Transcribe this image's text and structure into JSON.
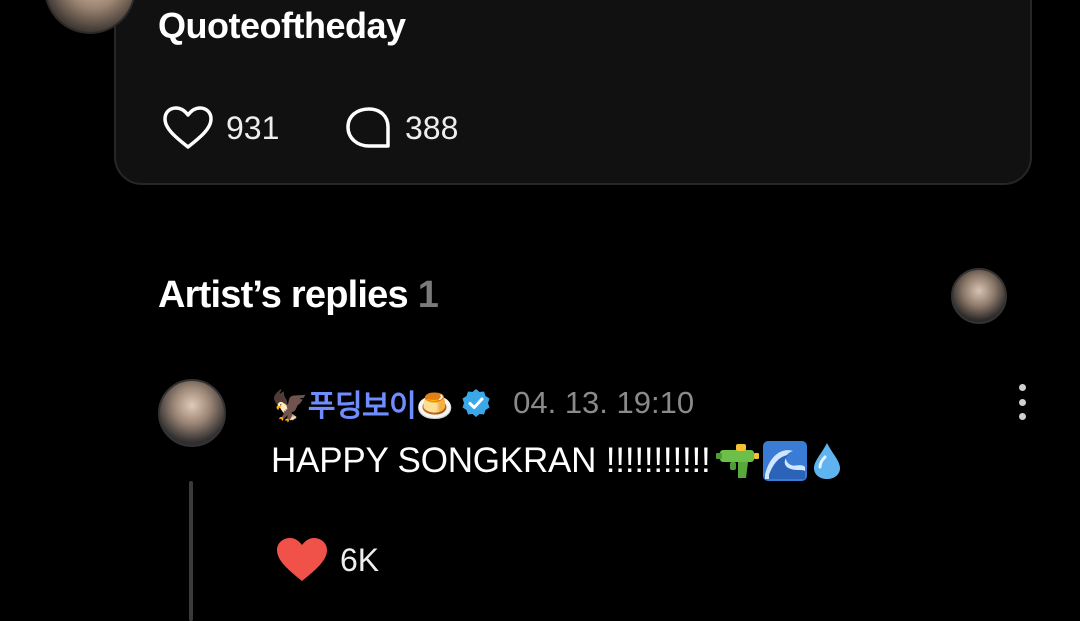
{
  "post": {
    "text": "Quoteoftheday",
    "likes": "931",
    "comments": "388",
    "avatar_icon": "user-avatar"
  },
  "artist_replies": {
    "title": "Artist’s replies",
    "count": "1",
    "avatar_icon": "artist-avatar"
  },
  "reply": {
    "author": "🦅푸딩보이🍮",
    "verified_icon": "verified-badge-icon",
    "date": "04. 13. 19:10",
    "text": "HAPPY SONGKRAN !!!!!!!!!!!",
    "emojis": [
      "water-gun-icon",
      "wave-icon",
      "droplet-icon"
    ],
    "likes": "6K",
    "liked": true,
    "more_icon": "more-vertical-icon"
  },
  "colors": {
    "background": "#000000",
    "card": "#111111",
    "author_name": "#6f8dff",
    "verified": "#3aa8e8",
    "liked_heart": "#f0524a",
    "muted": "#8a8a8a"
  }
}
